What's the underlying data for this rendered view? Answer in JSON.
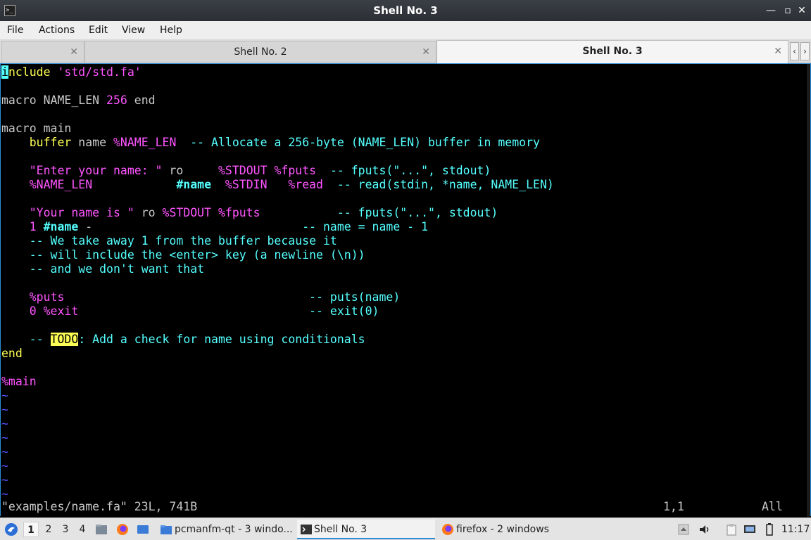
{
  "window": {
    "title": "Shell No. 3",
    "controls": {
      "minimize": "—",
      "restore": "▫",
      "maximize": "□",
      "close": "✕"
    }
  },
  "menu": [
    "File",
    "Actions",
    "Edit",
    "View",
    "Help"
  ],
  "tabs": [
    {
      "label": "",
      "close": "✕"
    },
    {
      "label": "Shell No. 2",
      "close": "✕"
    },
    {
      "label": "Shell No. 3",
      "close": "✕",
      "active": true
    }
  ],
  "tab_arrows": {
    "left": "‹",
    "right": "›"
  },
  "editor": {
    "status_file": "\"examples/name.fa\" 23L, 741B",
    "status_pos": "1,1",
    "status_scroll": "All",
    "tilde": "~"
  },
  "taskbar": {
    "workspaces": [
      "1",
      "2",
      "3",
      "4"
    ],
    "windows": [
      {
        "label": "pcmanfm-qt - 3 windo...",
        "icon": "folder-icon"
      },
      {
        "label": "Shell No. 3",
        "icon": "terminal-icon",
        "active": true
      },
      {
        "label": "firefox - 2 windows",
        "icon": "firefox-icon"
      }
    ],
    "clock": "11:17"
  },
  "colors": {
    "accent": "#2b8cd6",
    "keyword": "#ffff55",
    "string": "#ff55ff",
    "comment": "#55ffff",
    "tilde": "#5555ff"
  }
}
